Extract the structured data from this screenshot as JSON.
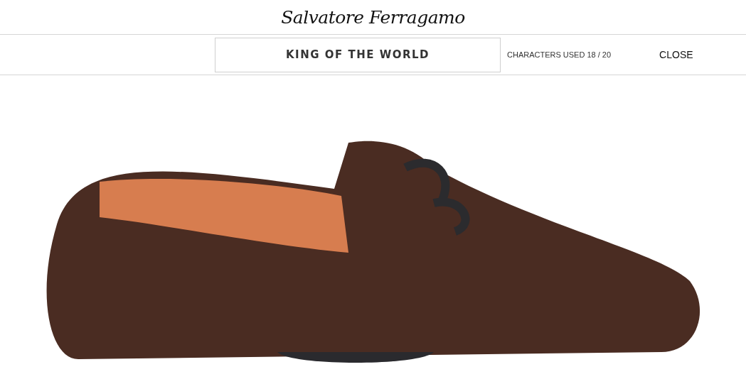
{
  "header": {
    "logo": "Salvatore Ferragamo"
  },
  "engraving": {
    "value": "KING OF THE WORLD",
    "counter": "CHARACTERS USED 18 / 20",
    "close": "CLOSE"
  }
}
